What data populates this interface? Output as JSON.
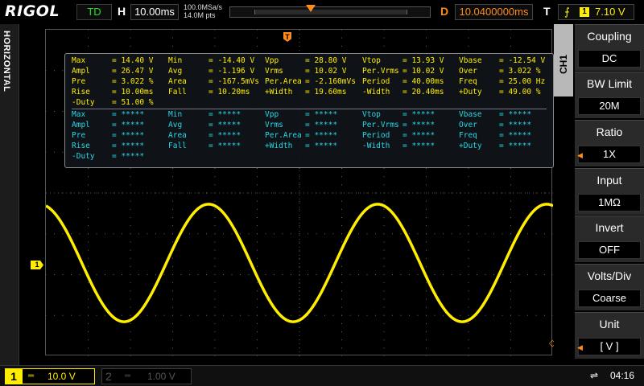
{
  "topbar": {
    "brand": "RIGOL",
    "run_state": "TD",
    "horizontal_label": "H",
    "timebase": "10.00ms",
    "sample_rate": "100.0MSa/s",
    "memory_depth": "14.0M pts",
    "delay_label": "D",
    "delay_value": "10.0400000ms",
    "trigger_label": "T",
    "trigger_edge": "rising-edge-icon",
    "trigger_channel": "1",
    "trigger_level": "7.10 V"
  },
  "left_strip": {
    "label": "HORIZONTAL"
  },
  "markers": {
    "trigger_position": "T",
    "ch1_ground": "1",
    "trigger_level_icon": "◇"
  },
  "measurements": {
    "primary": [
      [
        {
          "label": "Max",
          "value": "14.40 V"
        },
        {
          "label": "Min",
          "value": "-14.40 V"
        },
        {
          "label": "Vpp",
          "value": "28.80 V"
        },
        {
          "label": "Vtop",
          "value": "13.93 V"
        },
        {
          "label": "Vbase",
          "value": "-12.54 V"
        }
      ],
      [
        {
          "label": "Ampl",
          "value": "26.47 V"
        },
        {
          "label": "Avg",
          "value": "-1.196 V"
        },
        {
          "label": "Vrms",
          "value": "10.02 V"
        },
        {
          "label": "Per.Vrms",
          "value": "10.02 V"
        },
        {
          "label": "Over",
          "value": "3.022 %"
        }
      ],
      [
        {
          "label": "Pre",
          "value": "3.022 %"
        },
        {
          "label": "Area",
          "value": "-167.5mVs"
        },
        {
          "label": "Per.Area",
          "value": "-2.160mVs"
        },
        {
          "label": "Period",
          "value": "40.00ms"
        },
        {
          "label": "Freq",
          "value": "25.00 Hz"
        }
      ],
      [
        {
          "label": "Rise",
          "value": "10.00ms"
        },
        {
          "label": "Fall",
          "value": "10.20ms"
        },
        {
          "label": "+Width",
          "value": "19.60ms"
        },
        {
          "label": "-Width",
          "value": "20.40ms"
        },
        {
          "label": "+Duty",
          "value": "49.00 %"
        }
      ],
      [
        {
          "label": "-Duty",
          "value": "51.00 %"
        }
      ]
    ],
    "secondary": [
      [
        {
          "label": "Max",
          "value": "*****"
        },
        {
          "label": "Min",
          "value": "*****"
        },
        {
          "label": "Vpp",
          "value": "*****"
        },
        {
          "label": "Vtop",
          "value": "*****"
        },
        {
          "label": "Vbase",
          "value": "*****"
        }
      ],
      [
        {
          "label": "Ampl",
          "value": "*****"
        },
        {
          "label": "Avg",
          "value": "*****"
        },
        {
          "label": "Vrms",
          "value": "*****"
        },
        {
          "label": "Per.Vrms",
          "value": "*****"
        },
        {
          "label": "Over",
          "value": "*****"
        }
      ],
      [
        {
          "label": "Pre",
          "value": "*****"
        },
        {
          "label": "Area",
          "value": "*****"
        },
        {
          "label": "Per.Area",
          "value": "*****"
        },
        {
          "label": "Period",
          "value": "*****"
        },
        {
          "label": "Freq",
          "value": "*****"
        }
      ],
      [
        {
          "label": "Rise",
          "value": "*****"
        },
        {
          "label": "Fall",
          "value": "*****"
        },
        {
          "label": "+Width",
          "value": "*****"
        },
        {
          "label": "-Width",
          "value": "*****"
        },
        {
          "label": "+Duty",
          "value": "*****"
        }
      ],
      [
        {
          "label": "-Duty",
          "value": "*****"
        }
      ]
    ]
  },
  "menu": {
    "channel_tab": "CH1",
    "items": [
      {
        "label": "Coupling",
        "value": "DC"
      },
      {
        "label": "BW Limit",
        "value": "20M"
      },
      {
        "label": "Ratio",
        "value": "1X"
      },
      {
        "label": "Input",
        "value": "1MΩ"
      },
      {
        "label": "Invert",
        "value": "OFF"
      },
      {
        "label": "Volts/Div",
        "value": "Coarse"
      },
      {
        "label": "Unit",
        "value": "[  V  ]"
      }
    ]
  },
  "bottombar": {
    "ch1": {
      "number": "1",
      "coupling": "═",
      "scale": "10.0 V"
    },
    "ch2": {
      "number": "2",
      "coupling": "═",
      "scale": "1.00 V"
    },
    "usb_icon": "usb-icon",
    "time": "04:16"
  },
  "colors": {
    "ch1": "#ffee00",
    "trigger": "#ff8c1a",
    "meas_secondary": "#28d8e8"
  },
  "chart_data": {
    "type": "line",
    "series": [
      {
        "waveform": "sine",
        "frequency_hz": 25.0,
        "vpp": 28.8,
        "period_ms": 40.0
      }
    ],
    "timebase_per_div": "10.00ms",
    "volts_per_div": "10.0 V"
  }
}
